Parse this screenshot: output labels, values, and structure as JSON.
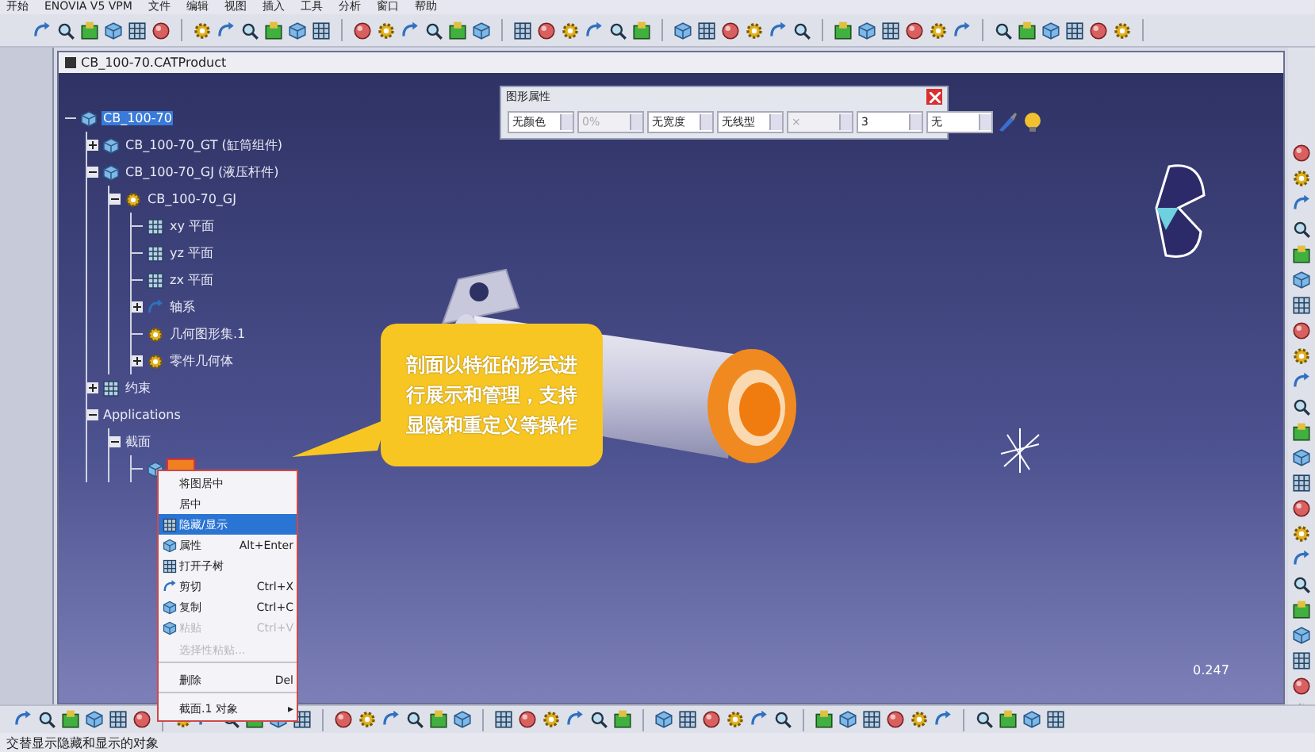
{
  "menu_bar": [
    "开始",
    "ENOVIA V5 VPM",
    "文件",
    "编辑",
    "视图",
    "插入",
    "工具",
    "分析",
    "窗口",
    "帮助"
  ],
  "window": {
    "title": "CB_100-70.CATProduct"
  },
  "tree": [
    {
      "label": "CB_100-70",
      "kind": "product",
      "selected": true,
      "children": [
        {
          "label": "CB_100-70_GT (缸筒组件)",
          "kind": "product",
          "selected": false,
          "expanded": false
        },
        {
          "label": "CB_100-70_GJ (液压杆件)",
          "kind": "product",
          "selected": false,
          "expanded": true,
          "children": [
            {
              "label": "CB_100-70_GJ",
              "kind": "part",
              "selected": false,
              "expanded": true,
              "children": [
                {
                  "label": "xy 平面",
                  "kind": "plane",
                  "selected": false
                },
                {
                  "label": "yz 平面",
                  "kind": "plane",
                  "selected": false
                },
                {
                  "label": "zx 平面",
                  "kind": "plane",
                  "selected": false
                },
                {
                  "label": "轴系",
                  "kind": "axis",
                  "selected": false,
                  "expanded": false
                },
                {
                  "label": "几何图形集.1",
                  "kind": "geoset",
                  "selected": false
                },
                {
                  "label": "零件几何体",
                  "kind": "body",
                  "selected": false,
                  "expanded": false
                }
              ]
            }
          ]
        },
        {
          "label": "约束",
          "kind": "constraint",
          "selected": false,
          "expanded": false
        },
        {
          "label": "Applications",
          "kind": "folder",
          "selected": false,
          "expanded": true,
          "children": [
            {
              "label": "截面",
              "kind": "folder",
              "selected": false,
              "expanded": true,
              "children": [
                {
                  "kind": "section",
                  "selected": true
                }
              ]
            }
          ]
        }
      ]
    }
  ],
  "graphic_properties": {
    "title": "图形属性",
    "fields": [
      {
        "value": "无颜色",
        "disabled": false
      },
      {
        "value": "0%",
        "disabled": true
      },
      {
        "value": "无宽度",
        "disabled": false
      },
      {
        "value": "无线型",
        "disabled": false
      },
      {
        "value": "×",
        "disabled": true
      },
      {
        "value": "3",
        "disabled": false
      },
      {
        "value": "无",
        "disabled": false
      }
    ]
  },
  "callout": {
    "text": "剖面以特征的形式进行展示和管理，支持显隐和重定义等操作"
  },
  "scale_label": "0.247",
  "context_menu": [
    {
      "label": "将图居中",
      "selected": false,
      "disabled": false
    },
    {
      "label": "居中",
      "selected": false,
      "disabled": false
    },
    {
      "label": "隐藏/显示",
      "kind": "hide",
      "selected": true,
      "disabled": false
    },
    {
      "label": "属性",
      "shortcut": "Alt+Enter",
      "kind": "properties",
      "selected": false,
      "disabled": false
    },
    {
      "label": "打开子树",
      "kind": "tree",
      "selected": false,
      "disabled": false
    },
    {
      "label": "剪切",
      "shortcut": "Ctrl+X",
      "kind": "cut",
      "selected": false,
      "disabled": false
    },
    {
      "label": "复制",
      "shortcut": "Ctrl+C",
      "kind": "copy",
      "selected": false,
      "disabled": false
    },
    {
      "label": "粘贴",
      "shortcut": "Ctrl+V",
      "kind": "paste",
      "selected": false,
      "disabled": true
    },
    {
      "label": "选择性粘贴...",
      "selected": false,
      "disabled": true,
      "separator_after": true
    },
    {
      "label": "删除",
      "shortcut": "Del",
      "selected": false,
      "disabled": false,
      "separator_after": true
    },
    {
      "label": "截面.1 对象",
      "submenu": "▸",
      "selected": false,
      "disabled": false
    }
  ],
  "status_bar": "交替显示隐藏和显示的对象"
}
